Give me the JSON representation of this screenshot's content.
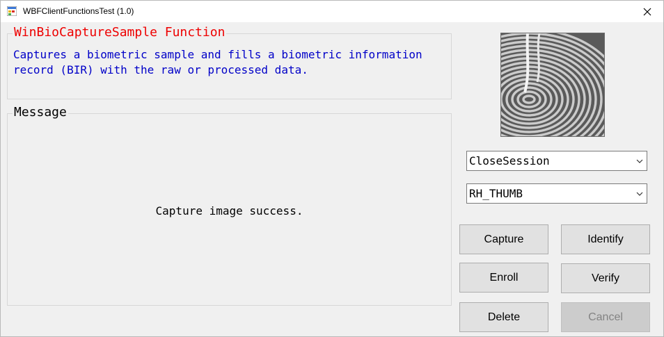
{
  "window": {
    "title": "WBFClientFunctionsTest (1.0)"
  },
  "function_panel": {
    "title": "WinBioCaptureSample Function",
    "description": "Captures a biometric sample and fills a biometric information record (BIR) with the raw or processed data."
  },
  "message_panel": {
    "title": "Message",
    "text": "Capture image success."
  },
  "fingerprint_image": {
    "icon": "fingerprint-image"
  },
  "function_select": {
    "value": "CloseSession"
  },
  "finger_select": {
    "value": "RH_THUMB"
  },
  "buttons": {
    "capture": "Capture",
    "identify": "Identify",
    "enroll": "Enroll",
    "verify": "Verify",
    "delete": "Delete",
    "cancel": "Cancel"
  },
  "colors": {
    "function_title": "#ee0000",
    "description_text": "#0000c8",
    "background": "#f0f0f0"
  }
}
